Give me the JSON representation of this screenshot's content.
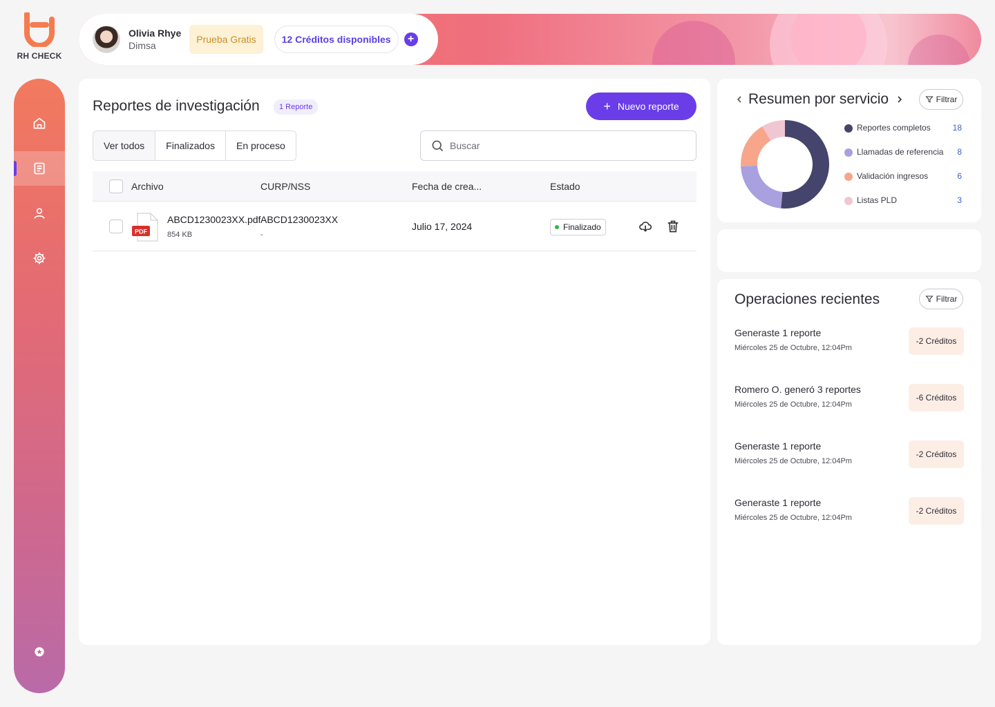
{
  "brand": {
    "name": "RH CHECK",
    "color": "#f47c50"
  },
  "nav": [
    {
      "name": "home",
      "icon": "home-icon",
      "active": false
    },
    {
      "name": "reports",
      "icon": "document-icon",
      "active": true
    },
    {
      "name": "users",
      "icon": "user-icon",
      "active": false
    },
    {
      "name": "settings",
      "icon": "gear-icon",
      "active": false
    },
    {
      "name": "favorites",
      "icon": "star-icon",
      "active": false
    }
  ],
  "user": {
    "name": "Olivia Rhye",
    "company": "Dimsa",
    "trial": "Prueba Gratis",
    "credits": "12 Créditos disponibles"
  },
  "reports": {
    "title": "Reportes de investigación",
    "count_badge": "1 Reporte",
    "new_button": "Nuevo reporte",
    "tabs": [
      "Ver todos",
      "Finalizados",
      "En proceso"
    ],
    "search_placeholder": "Buscar",
    "columns": {
      "file": "Archivo",
      "curp": "CURP/NSS",
      "date": "Fecha de crea...",
      "status": "Estado"
    },
    "rows": [
      {
        "file_name": "ABCD1230023XX.pdf",
        "file_size": "854 KB",
        "file_type": "PDF",
        "curp": "ABCD1230023XX",
        "nss": "-",
        "date": "Julio 17, 2024",
        "status": "Finalizado"
      }
    ]
  },
  "summary": {
    "title": "Resumen por servicio",
    "filter": "Filtrar",
    "items": [
      {
        "label": "Reportes completos",
        "value": 18,
        "color": "#45446c"
      },
      {
        "label": "Llamadas de referencia",
        "value": 8,
        "color": "#a9a0df"
      },
      {
        "label": "Validación ingresos",
        "value": 6,
        "color": "#f7a68c"
      },
      {
        "label": "Listas PLD",
        "value": 3,
        "color": "#f0c6d3"
      }
    ]
  },
  "operations": {
    "title": "Operaciones recientes",
    "filter": "Filtrar",
    "items": [
      {
        "title": "Generaste 1 reporte",
        "date": "Miércoles 25 de Octubre, 12:04Pm",
        "credits": "-2 Créditos"
      },
      {
        "title": "Romero O. generó 3 reportes",
        "date": "Miércoles 25 de Octubre, 12:04Pm",
        "credits": "-6 Créditos"
      },
      {
        "title": "Generaste 1 reporte",
        "date": "Miércoles 25 de Octubre, 12:04Pm",
        "credits": "-2 Créditos"
      },
      {
        "title": "Generaste 1 reporte",
        "date": "Miércoles 25 de Octubre, 12:04Pm",
        "credits": "-2 Créditos"
      }
    ]
  }
}
